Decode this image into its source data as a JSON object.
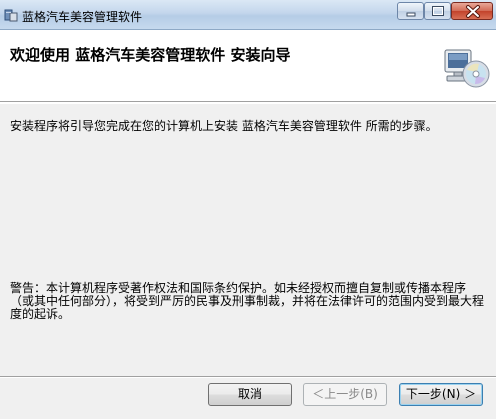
{
  "window": {
    "title": "蓝格汽车美容管理软件",
    "icon": "installer-icon"
  },
  "header": {
    "title": "欢迎使用  蓝格汽车美容管理软件  安装向导",
    "graphic": "computer-cd-icon"
  },
  "body": {
    "intro": "安装程序将引导您完成在您的计算机上安装  蓝格汽车美容管理软件  所需的步骤。",
    "warning": "警告：本计算机程序受著作权法和国际条约保护。如未经授权而擅自复制或传播本程序（或其中任何部分），将受到严厉的民事及刑事制裁，并将在法律许可的范围内受到最大程度的起诉。"
  },
  "buttons": {
    "cancel": "取消",
    "back": "＜上一步(B)",
    "next": "下一步(N) ＞"
  }
}
